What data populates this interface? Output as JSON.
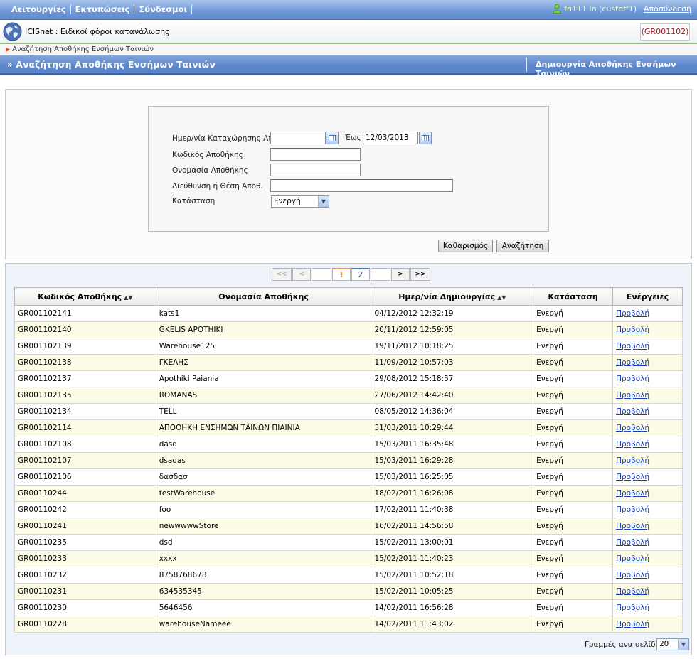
{
  "menu": [
    "Λειτουργίες",
    "Εκτυπώσεις",
    "Σύνδεσμοι"
  ],
  "user": {
    "text": "fn111 ln (custoff1)",
    "logout": "Αποσύνδεση"
  },
  "app": {
    "title": "ICISnet : Ειδικοί φόροι κατανάλωσης",
    "code": "(GR001102)"
  },
  "breadcrumb": "Αναζήτηση Αποθήκης Ενσήμων Ταινιών",
  "header": {
    "title": "» Αναζήτηση Αποθήκης Ενσήμων Ταινιών",
    "action": "Δημιουργία Αποθήκης Ενσήμων Ταινιών"
  },
  "search": {
    "date_from_label": "Ημερ/νία Καταχώρησης Από",
    "date_from_value": "",
    "date_to_label": "Έως",
    "date_to_value": "12/03/2013",
    "code_label": "Κωδικός Αποθήκης",
    "name_label": "Ονομασία Αποθήκης",
    "address_label": "Διεύθυνση ή Θέση Αποθ.",
    "status_label": "Κατάσταση",
    "status_value": "Ενεργή",
    "clear_button": "Καθαρισμός",
    "search_button": "Αναζήτηση"
  },
  "pager": {
    "first": "<<",
    "prev": "<",
    "pages": [
      "1",
      "2"
    ],
    "next": ">",
    "last": ">>",
    "active": "1"
  },
  "table": {
    "columns": [
      "Κωδικός Αποθήκης",
      "Ονομασία Αποθήκης",
      "Ημερ/νία Δημιουργίας",
      "Κατάσταση",
      "Ενέργειες"
    ],
    "rows": [
      [
        "GR001102141",
        "kats1",
        "04/12/2012 12:32:19",
        "Ενεργή",
        "Προβολή"
      ],
      [
        "GR001102140",
        "GKELIS APOTHIKI",
        "20/11/2012 12:59:05",
        "Ενεργή",
        "Προβολή"
      ],
      [
        "GR001102139",
        "Warehouse125",
        "19/11/2012 10:18:25",
        "Ενεργή",
        "Προβολή"
      ],
      [
        "GR001102138",
        "ΓΚΕΛΗΣ",
        "11/09/2012 10:57:03",
        "Ενεργή",
        "Προβολή"
      ],
      [
        "GR001102137",
        "Apothiki Paiania",
        "29/08/2012 15:18:57",
        "Ενεργή",
        "Προβολή"
      ],
      [
        "GR001102135",
        "ROMANAS",
        "27/06/2012 14:42:40",
        "Ενεργή",
        "Προβολή"
      ],
      [
        "GR001102134",
        "TELL",
        "08/05/2012 14:36:04",
        "Ενεργή",
        "Προβολή"
      ],
      [
        "GR001102114",
        "ΑΠΟΘΗΚΗ ΕΝΣΗΜΩΝ ΤΑΙΝΩΝ ΠΙΑΙΝΙΑ",
        "31/03/2011 10:29:44",
        "Ενεργή",
        "Προβολή"
      ],
      [
        "GR001102108",
        "dasd",
        "15/03/2011 16:35:48",
        "Ενεργή",
        "Προβολή"
      ],
      [
        "GR001102107",
        "dsadas",
        "15/03/2011 16:29:28",
        "Ενεργή",
        "Προβολή"
      ],
      [
        "GR001102106",
        "δασδασ",
        "15/03/2011 16:25:05",
        "Ενεργή",
        "Προβολή"
      ],
      [
        "GR00110244",
        "testWarehouse",
        "18/02/2011 16:26:08",
        "Ενεργή",
        "Προβολή"
      ],
      [
        "GR00110242",
        "foo",
        "17/02/2011 11:40:38",
        "Ενεργή",
        "Προβολή"
      ],
      [
        "GR00110241",
        "newwwwwStore",
        "16/02/2011 14:56:58",
        "Ενεργή",
        "Προβολή"
      ],
      [
        "GR00110235",
        "dsd",
        "15/02/2011 13:00:01",
        "Ενεργή",
        "Προβολή"
      ],
      [
        "GR00110233",
        "xxxx",
        "15/02/2011 11:40:23",
        "Ενεργή",
        "Προβολή"
      ],
      [
        "GR00110232",
        "8758768678",
        "15/02/2011 10:52:18",
        "Ενεργή",
        "Προβολή"
      ],
      [
        "GR00110231",
        "634535345",
        "15/02/2011 10:05:25",
        "Ενεργή",
        "Προβολή"
      ],
      [
        "GR00110230",
        "5646456",
        "14/02/2011 16:56:28",
        "Ενεργή",
        "Προβολή"
      ],
      [
        "GR00110228",
        "warehouseNameee",
        "14/02/2011 11:43:02",
        "Ενεργή",
        "Προβολή"
      ]
    ]
  },
  "rows_per_page": {
    "label": "Γραμμές ανα σελίδα:",
    "value": "20"
  },
  "colors": {
    "menu_bar": "#6f98d8",
    "header_band": "#5e88cc",
    "link": "#1a3fb7",
    "code_badge_text": "#a8141e",
    "alt_row": "#fcfbe6",
    "active_page": "#e07b0e"
  },
  "icons": [
    "user-icon",
    "globe-logo-icon",
    "calendar-icon",
    "chevron-down-icon",
    "sort-icon"
  ]
}
